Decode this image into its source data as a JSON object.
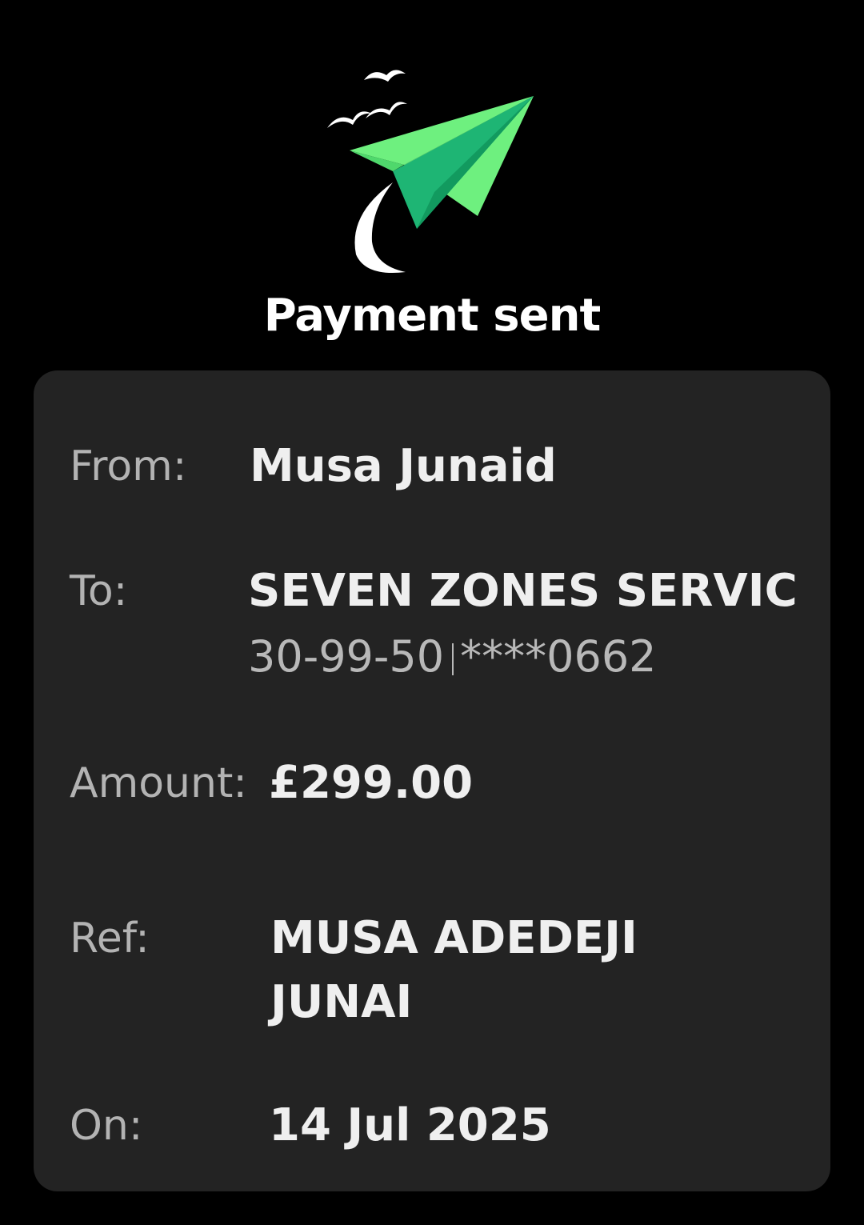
{
  "header": {
    "title": "Payment sent",
    "icon": "paper-plane-icon",
    "colors": {
      "plane_light": "#6ef07f",
      "plane_dark": "#1eb574"
    }
  },
  "details": {
    "from": {
      "label": "From:",
      "value": "Musa Junaid"
    },
    "to": {
      "label": "To:",
      "value": "SEVEN ZONES SERVIC",
      "sort_code": "30-99-50",
      "account": "****0662"
    },
    "amount": {
      "label": "Amount:",
      "value": "£299.00"
    },
    "ref": {
      "label": "Ref:",
      "value_line1": "MUSA ADEDEJI",
      "value_line2": "JUNAI"
    },
    "on": {
      "label": "On:",
      "value": "14 Jul 2025"
    }
  },
  "colors": {
    "background": "#000000",
    "card": "#232323",
    "label": "#b3b3b3",
    "value": "#efefef"
  }
}
